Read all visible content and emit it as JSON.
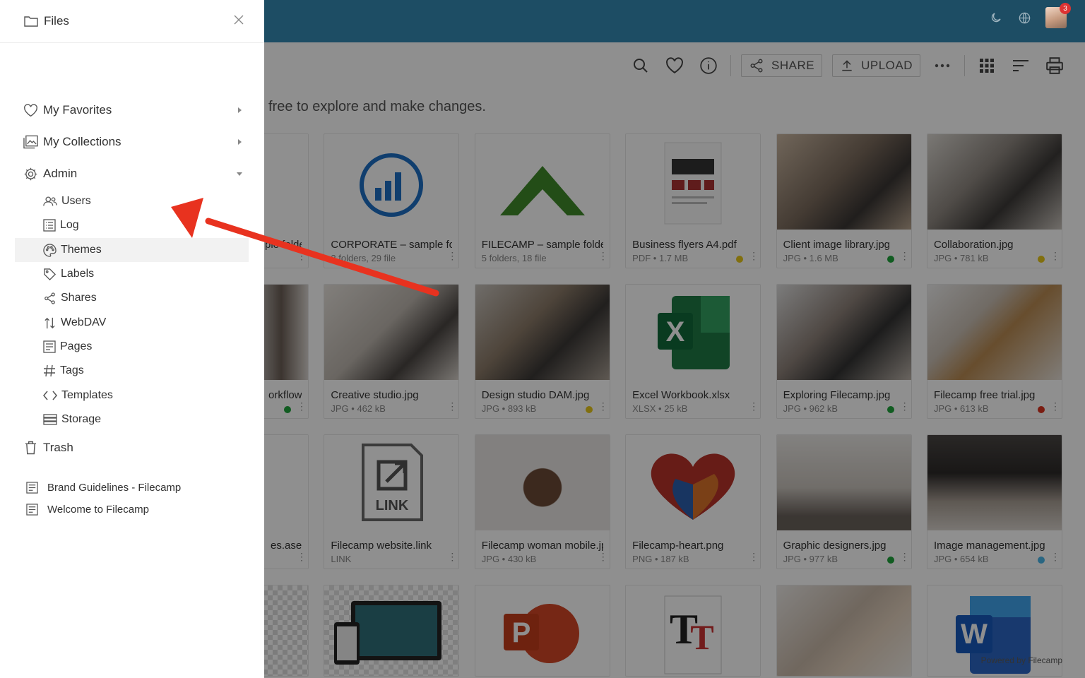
{
  "sidebar": {
    "title": "Files",
    "items": [
      {
        "label": "My Favorites"
      },
      {
        "label": "My Collections"
      },
      {
        "label": "Admin"
      }
    ],
    "admin_items": [
      {
        "label": "Users"
      },
      {
        "label": "Log"
      },
      {
        "label": "Themes"
      },
      {
        "label": "Labels"
      },
      {
        "label": "Shares"
      },
      {
        "label": "WebDAV"
      },
      {
        "label": "Pages"
      },
      {
        "label": "Tags"
      },
      {
        "label": "Templates"
      },
      {
        "label": "Storage"
      }
    ],
    "trash_label": "Trash",
    "pages": [
      {
        "label": "Brand Guidelines - Filecamp"
      },
      {
        "label": "Welcome to Filecamp"
      }
    ]
  },
  "topbar": {
    "notification_count": "3"
  },
  "toolbar": {
    "share_label": "SHARE",
    "upload_label": "UPLOAD"
  },
  "intro_text": "free to explore and make changes.",
  "grid": [
    {
      "name": "ple folder",
      "meta": "",
      "dot": ""
    },
    {
      "name": "CORPORATE – sample folder",
      "meta": "2 folders, 29 file",
      "dot": ""
    },
    {
      "name": "FILECAMP – sample folder",
      "meta": "5 folders, 18 file",
      "dot": ""
    },
    {
      "name": "Business flyers A4.pdf",
      "meta": "PDF • 1.7 MB",
      "dot": "#e6c619"
    },
    {
      "name": "Client image library.jpg",
      "meta": "JPG • 1.6 MB",
      "dot": "#1fa43b"
    },
    {
      "name": "Collaboration.jpg",
      "meta": "JPG • 781 kB",
      "dot": "#e6c619"
    },
    {
      "name": "orkflow.jpg",
      "meta": "",
      "dot": "#1fa43b"
    },
    {
      "name": "Creative studio.jpg",
      "meta": "JPG • 462 kB",
      "dot": ""
    },
    {
      "name": "Design studio DAM.jpg",
      "meta": "JPG • 893 kB",
      "dot": "#e6c619"
    },
    {
      "name": "Excel Workbook.xlsx",
      "meta": "XLSX • 25 kB",
      "dot": ""
    },
    {
      "name": "Exploring Filecamp.jpg",
      "meta": "JPG • 962 kB",
      "dot": "#1fa43b"
    },
    {
      "name": "Filecamp free trial.jpg",
      "meta": "JPG • 613 kB",
      "dot": "#d9321f"
    },
    {
      "name": "es.ase",
      "meta": "",
      "dot": ""
    },
    {
      "name": "Filecamp website.link",
      "meta": "LINK",
      "dot": ""
    },
    {
      "name": "Filecamp woman mobile.jpg",
      "meta": "JPG • 430 kB",
      "dot": ""
    },
    {
      "name": "Filecamp-heart.png",
      "meta": "PNG • 187 kB",
      "dot": ""
    },
    {
      "name": "Graphic designers.jpg",
      "meta": "JPG • 977 kB",
      "dot": "#1fa43b"
    },
    {
      "name": "Image management.jpg",
      "meta": "JPG • 654 kB",
      "dot": "#49b6e8"
    }
  ],
  "thumb_labels": {
    "link": "LINK",
    "excel": "X",
    "ppt": "P",
    "word": "W",
    "font": "T"
  },
  "footer": {
    "powered": "Powered by Filecamp"
  },
  "colors": {
    "topbar": "#1d4d64",
    "arrow": "#e8321f",
    "highlight": "#f2f2f2"
  }
}
